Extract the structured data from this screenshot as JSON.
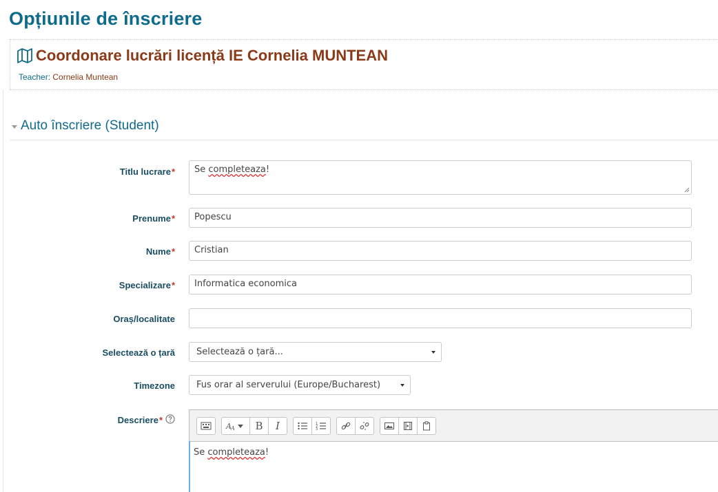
{
  "page": {
    "title": "Opțiunile de înscriere"
  },
  "course": {
    "title": "Coordonare lucrări licență IE Cornelia MUNTEAN",
    "teacher_label": "Teacher:",
    "teacher_name": "Cornelia Muntean"
  },
  "section": {
    "title": "Auto înscriere (Student)"
  },
  "form": {
    "required_marker": "*",
    "titlu": {
      "label": "Titlu lucrare",
      "value_plain": "Se ",
      "value_misspelled": "completeaza",
      "value_suffix": "!"
    },
    "prenume": {
      "label": "Prenume",
      "value": "Popescu"
    },
    "nume": {
      "label": "Nume",
      "value": "Cristian"
    },
    "specializare": {
      "label": "Specializare",
      "value": "Informatica economica"
    },
    "oras": {
      "label": "Oraș/localitate",
      "value": ""
    },
    "tara": {
      "label": "Selectează o țară",
      "selected": "Selectează o țară..."
    },
    "timezone": {
      "label": "Timezone",
      "selected": "Fus orar al serverului (Europe/Bucharest)"
    },
    "descriere": {
      "label": "Descriere",
      "content_plain": "Se ",
      "content_misspelled": "completeaza",
      "content_suffix": "!",
      "toolbar_icons": [
        "keyboard-icon",
        "font-size-icon",
        "bold-icon",
        "italic-icon",
        "bullet-list-icon",
        "numbered-list-icon",
        "link-icon",
        "unlink-icon",
        "image-icon",
        "media-icon",
        "paste-icon"
      ],
      "toolbar_bold_glyph": "B",
      "toolbar_italic_glyph": "I"
    }
  },
  "colors": {
    "heading": "#0f6b8a",
    "course_title": "#8a3a18",
    "label": "#1a4d63",
    "required": "#c0392b"
  }
}
